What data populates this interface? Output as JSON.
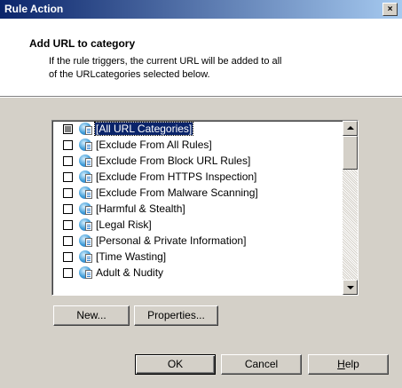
{
  "window": {
    "title": "Rule Action",
    "close_label": "×"
  },
  "header": {
    "title": "Add URL to category",
    "description_line1": "If the rule triggers, the current URL will be added to all",
    "description_line2": "of the URLcategories selected below."
  },
  "list": {
    "items": [
      {
        "label": "[All URL Categories]",
        "checked": "mixed",
        "selected": true
      },
      {
        "label": "[Exclude From All Rules]",
        "checked": false
      },
      {
        "label": "[Exclude From Block URL Rules]",
        "checked": false
      },
      {
        "label": "[Exclude From HTTPS Inspection]",
        "checked": false
      },
      {
        "label": "[Exclude From Malware Scanning]",
        "checked": false
      },
      {
        "label": "[Harmful & Stealth]",
        "checked": false
      },
      {
        "label": "[Legal Risk]",
        "checked": false
      },
      {
        "label": "[Personal & Private Information]",
        "checked": false
      },
      {
        "label": "[Time Wasting]",
        "checked": false
      },
      {
        "label": "Adult & Nudity",
        "checked": false
      }
    ]
  },
  "buttons": {
    "new": "New...",
    "properties": "Properties...",
    "ok": "OK",
    "cancel": "Cancel",
    "help_hotkey": "H",
    "help_rest": "elp"
  },
  "colors": {
    "titlebar_start": "#0a246a",
    "titlebar_end": "#a6caf0",
    "selection": "#0a246a",
    "dialog_face": "#d4d0c8"
  }
}
